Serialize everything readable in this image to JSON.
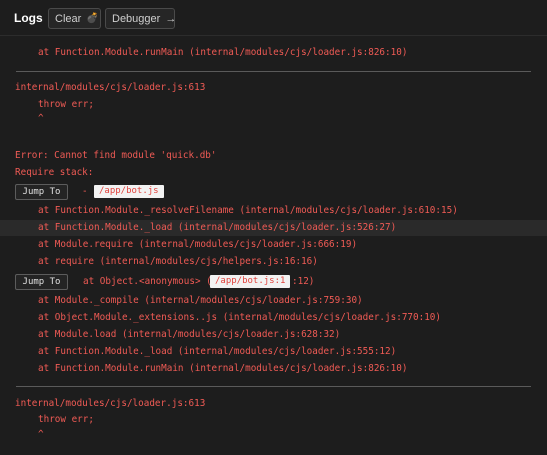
{
  "header": {
    "title": "Logs",
    "clear_label": "Clear",
    "debugger_label": "Debugger",
    "debugger_icon": "arrow-right-icon",
    "clear_icon": "bomb-icon"
  },
  "colors": {
    "error_text": "#f05b55",
    "background": "#1d1d1d",
    "separator": "#5a5a5a"
  },
  "log": {
    "top_line": "at Function.Module.runMain (internal/modules/cjs/loader.js:826:10)",
    "block1_file": "internal/modules/cjs/loader.js:613",
    "block1_throw": "throw err;",
    "block1_caret": "^",
    "error_message": "Error: Cannot find module 'quick.db'",
    "require_stack": "Require stack:",
    "jump1_label": "Jump To",
    "jump1_prefix": "-",
    "jump1_path": "/app/bot.js",
    "stack1": [
      "at Function.Module._resolveFilename (internal/modules/cjs/loader.js:610:15)",
      "at Function.Module._load (internal/modules/cjs/loader.js:526:27)",
      "at Module.require (internal/modules/cjs/loader.js:666:19)",
      "at require (internal/modules/cjs/helpers.js:16:16)"
    ],
    "jump2_label": "Jump To",
    "jump2_prefix": "at Object.<anonymous> (",
    "jump2_path": "/app/bot.js:1",
    "jump2_suffix": ":12)",
    "stack2": [
      "at Module._compile (internal/modules/cjs/loader.js:759:30)",
      "at Object.Module._extensions..js (internal/modules/cjs/loader.js:770:10)",
      "at Module.load (internal/modules/cjs/loader.js:628:32)",
      "at Function.Module._load (internal/modules/cjs/loader.js:555:12)",
      "at Function.Module.runMain (internal/modules/cjs/loader.js:826:10)"
    ],
    "block2_file": "internal/modules/cjs/loader.js:613",
    "block2_throw": "throw err;",
    "block2_caret": "^"
  }
}
